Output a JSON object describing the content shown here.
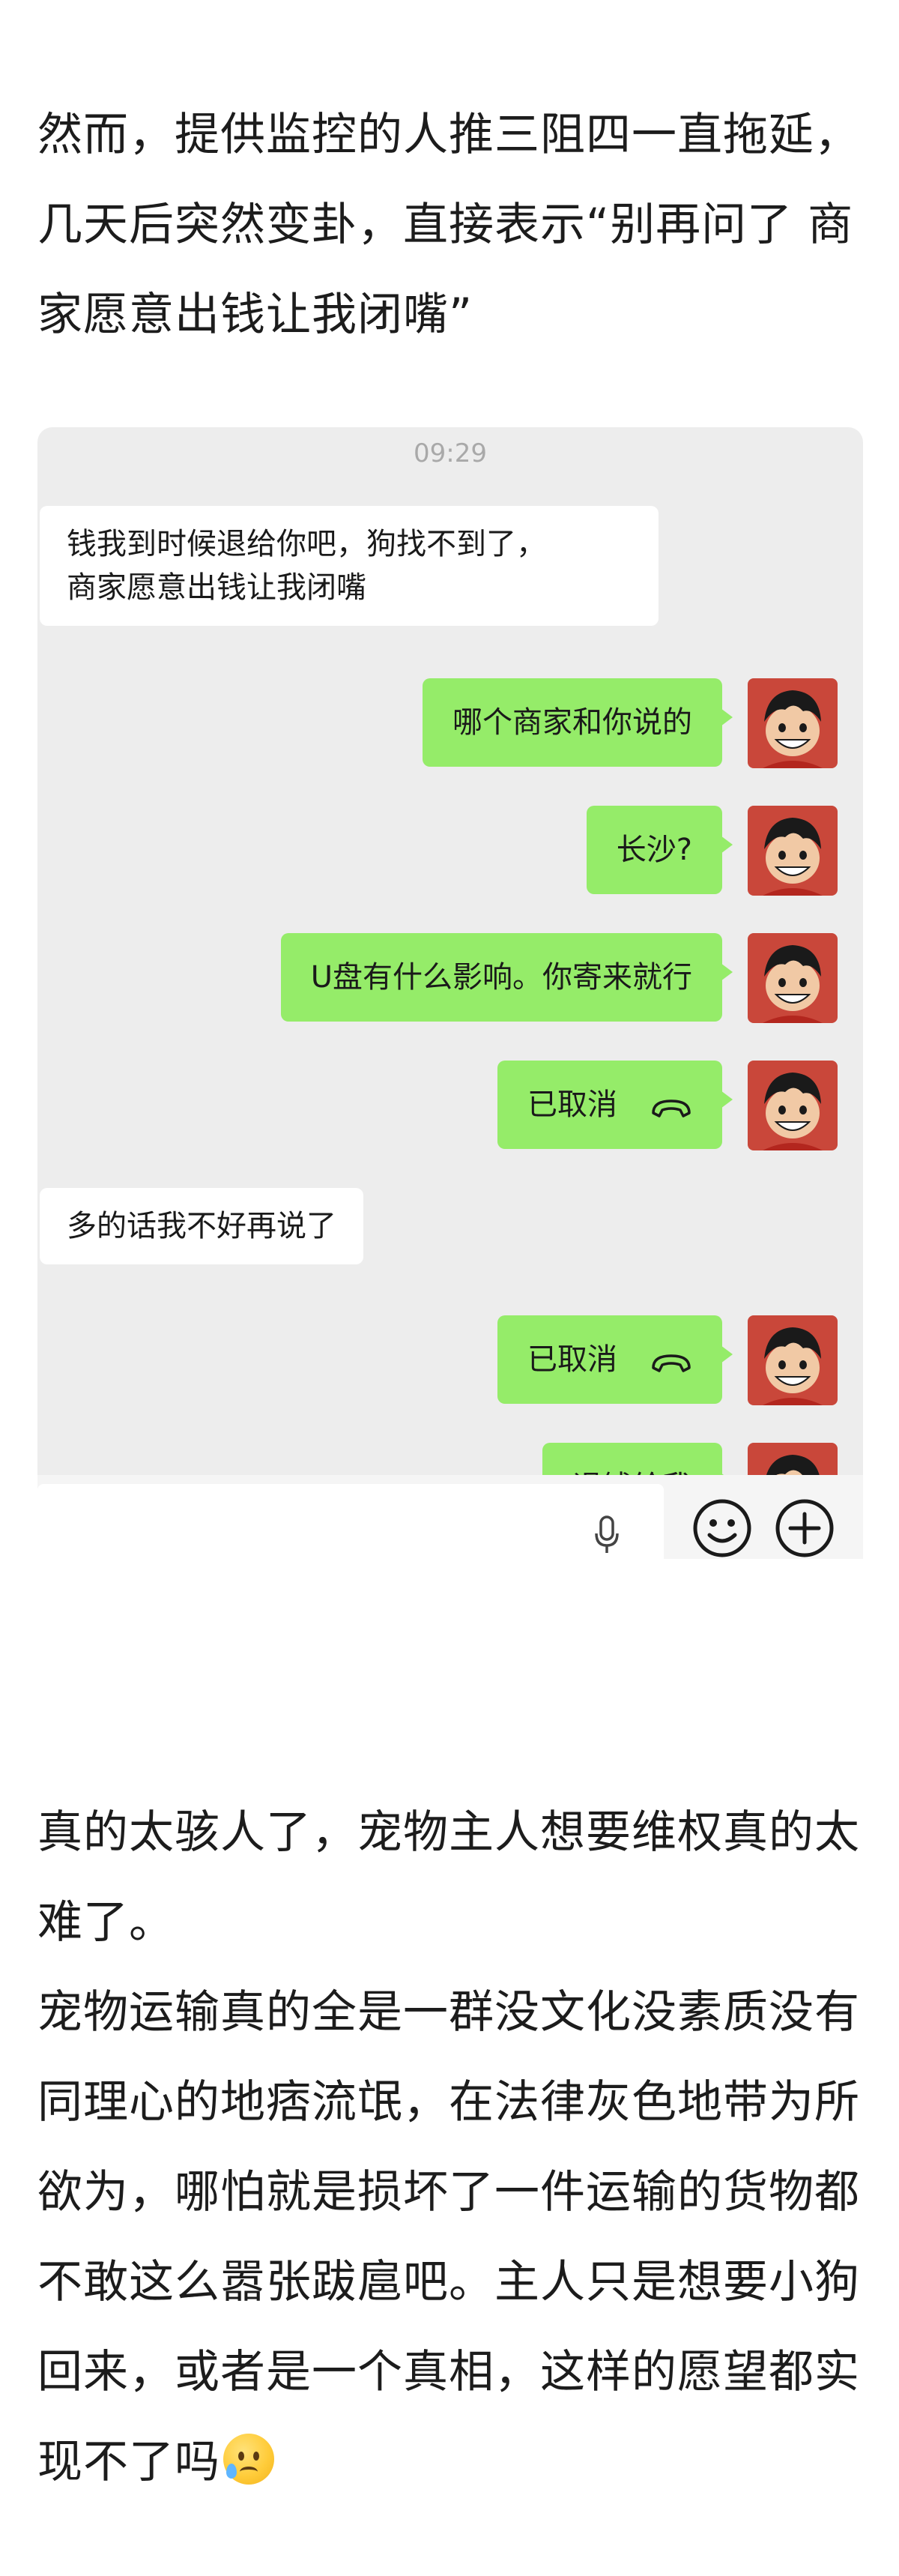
{
  "article": {
    "para1": "然而，提供监控的人推三阻四一直拖延，几天后突然变卦，直接表示“别再问了 商家愿意出钱让我闭嘴”",
    "para2": "真的太骇人了，宠物主人想要维权真的太难了。",
    "para3": "宠物运输真的全是一群没文化没素质没有同理心的地痞流氓，在法律灰色地带为所欲为，哪怕就是损坏了一件运输的货物都不敢这么嚣张跋扈吧。主人只是想要小狗回来，或者是一个真相，这样的愿望都实现不了吗",
    "emoji": "crying-smile-emoji"
  },
  "chat": {
    "timestamp": "09:29",
    "messages": [
      {
        "side": "in",
        "lines": [
          "钱我到时候退给你吧，狗找不到了，",
          "商家愿意出钱让我闭嘴"
        ]
      },
      {
        "side": "out",
        "text": "哪个商家和你说的"
      },
      {
        "side": "out",
        "text": "长沙?"
      },
      {
        "side": "out",
        "text": "U盘有什么影响。你寄来就行"
      },
      {
        "side": "out",
        "text": "已取消",
        "icon": "hangup-icon"
      },
      {
        "side": "in",
        "text": "多的话我不好再说了"
      },
      {
        "side": "out",
        "text": "已取消",
        "icon": "hangup-icon"
      },
      {
        "side": "out",
        "text": "退钱给我"
      }
    ],
    "input_bar": {
      "icons": [
        "mic-icon",
        "emoji-icon",
        "plus-icon"
      ]
    },
    "colors": {
      "background": "#ededed",
      "out_bubble": "#95ec69",
      "in_bubble": "#ffffff"
    }
  }
}
